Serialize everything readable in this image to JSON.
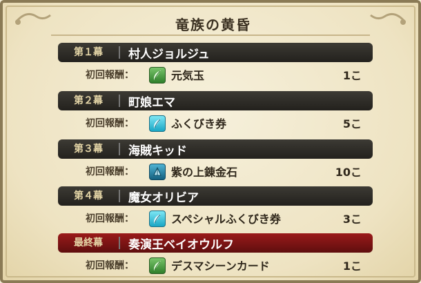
{
  "title": "竜族の黄昏",
  "reward_prefix": "初回報酬：",
  "chapters": [
    {
      "num": "第１幕",
      "name": "村人ジョルジュ",
      "reward": "元気玉",
      "count": "1こ",
      "icon": "green-leaf-icon",
      "final": false
    },
    {
      "num": "第２幕",
      "name": "町娘エマ",
      "reward": "ふくびき券",
      "count": "5こ",
      "icon": "cyan-leaf-icon",
      "final": false
    },
    {
      "num": "第３幕",
      "name": "海賊キッド",
      "reward": "紫の上錬金石",
      "count": "10こ",
      "icon": "blue-stone-icon",
      "final": false
    },
    {
      "num": "第４幕",
      "name": "魔女オリビア",
      "reward": "スペシャルふくびき券",
      "count": "3こ",
      "icon": "cyan-leaf-icon",
      "final": false
    },
    {
      "num": "最終幕",
      "name": "奏演王ベイオウルフ",
      "reward": "デスマシーンカード",
      "count": "1こ",
      "icon": "green-leaf-icon",
      "final": true
    }
  ],
  "colors": {
    "final_header": "#7a1414",
    "header": "#2e2c27",
    "parchment": "#f3ecd3"
  }
}
